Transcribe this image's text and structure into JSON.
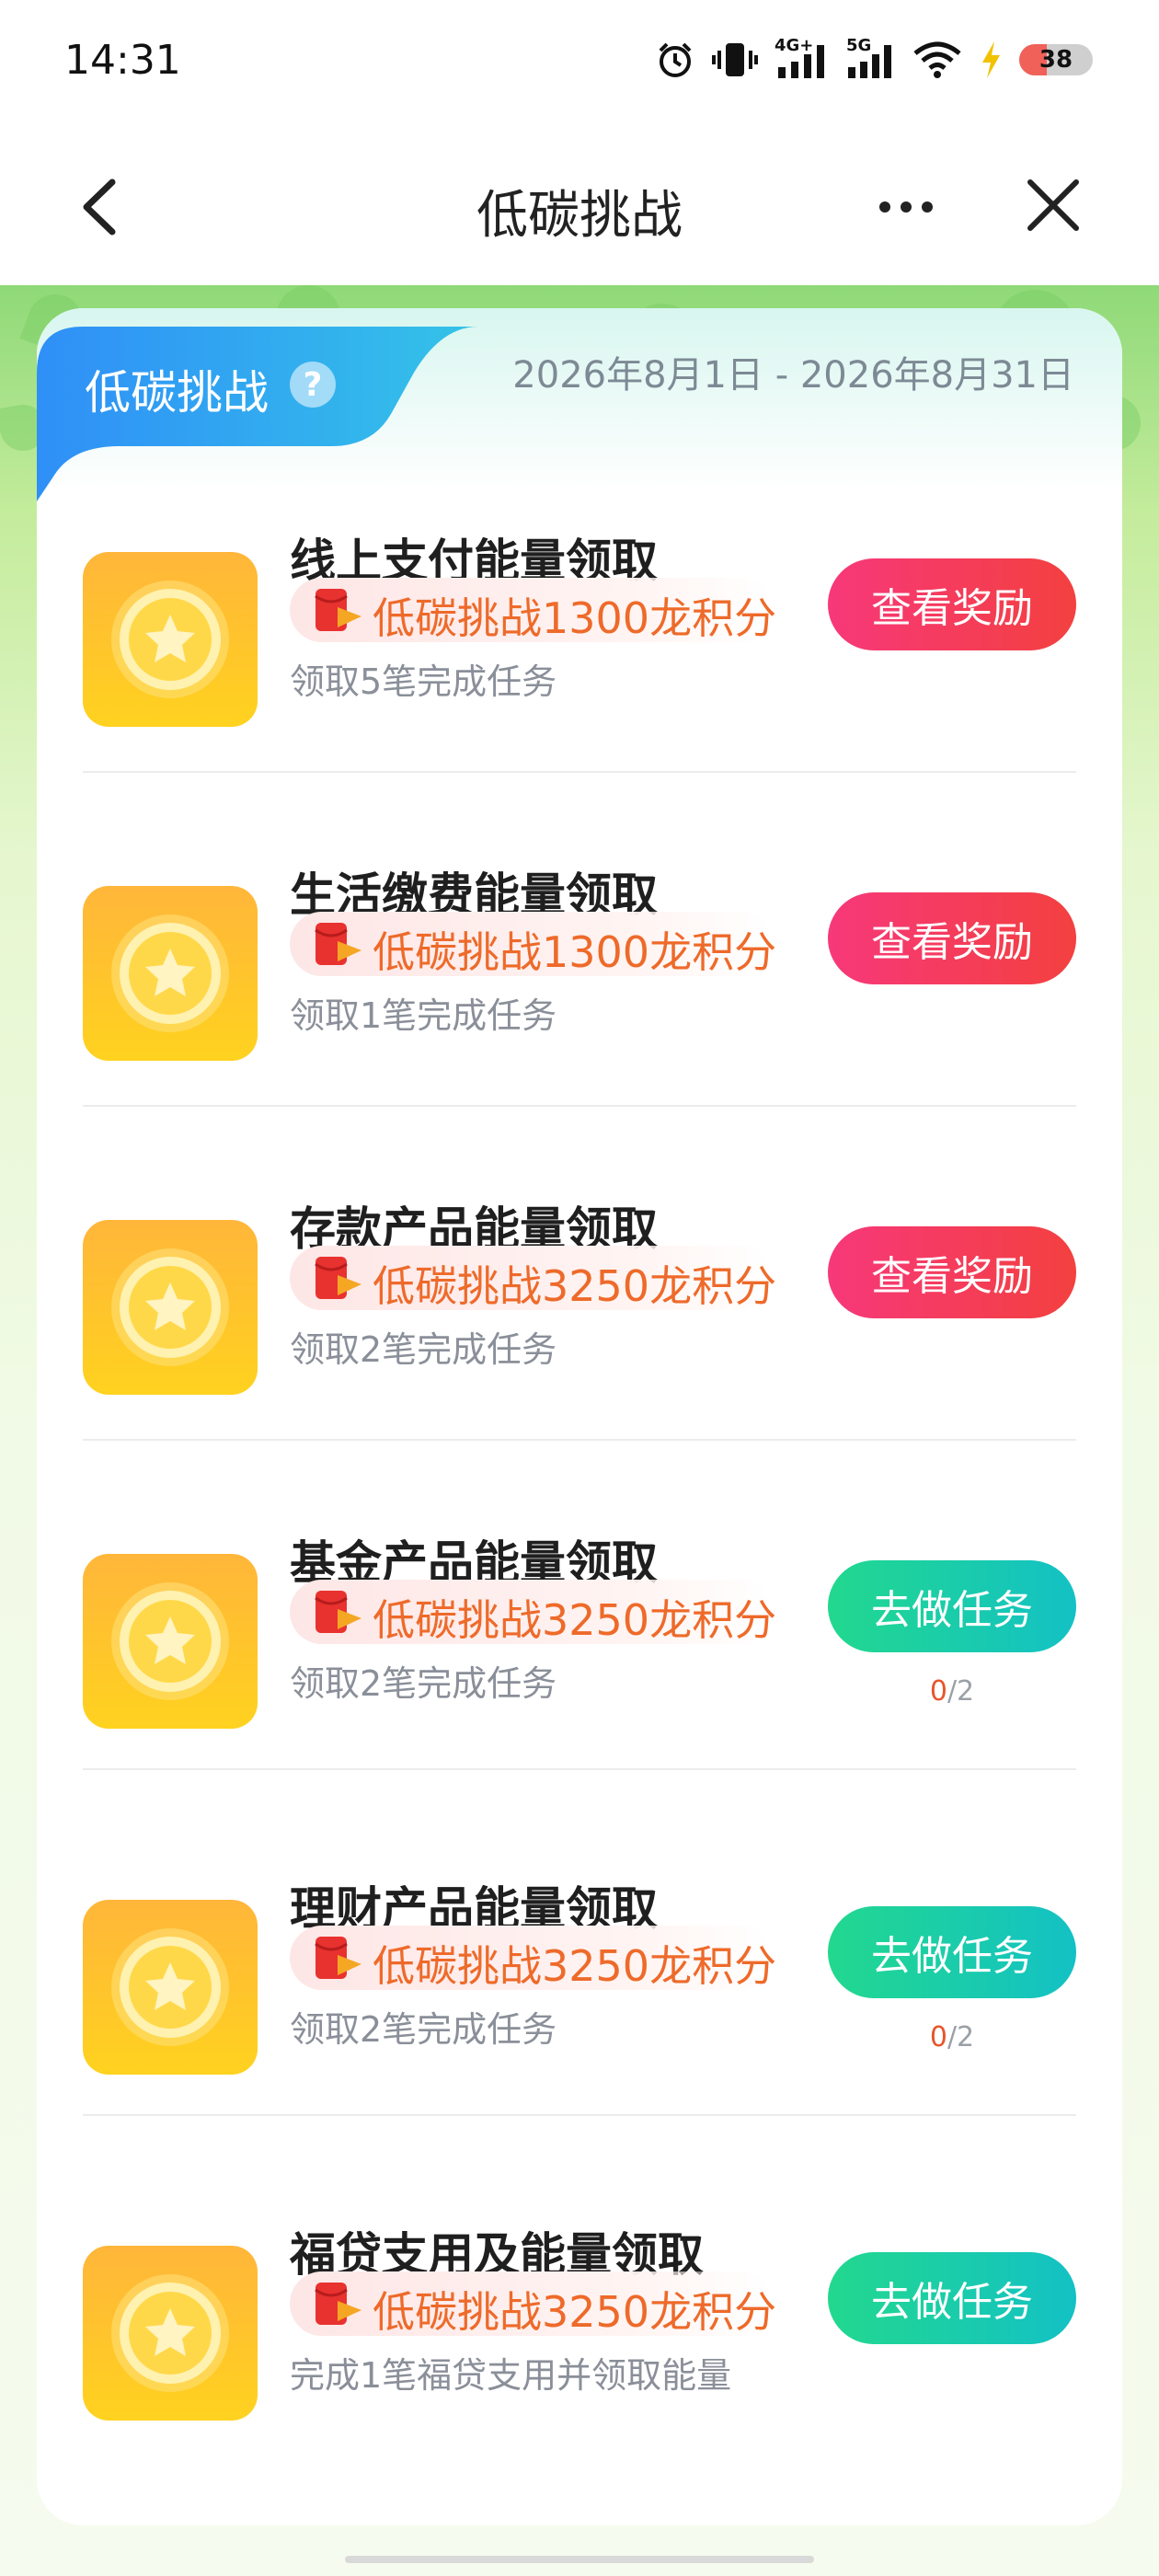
{
  "status_bar": {
    "time": "14:31",
    "battery": "38",
    "network_4g": "4G+",
    "network_5g": "5G"
  },
  "nav": {
    "title": "低碳挑战"
  },
  "card": {
    "tab_title": "低碳挑战",
    "help_glyph": "?",
    "date_range": "2026年8月1日 - 2026年8月31日"
  },
  "tasks": [
    {
      "name": "线上支付能量领取",
      "reward": "低碳挑战1300龙积分",
      "desc": "领取5笔完成任务",
      "button": "查看奖励",
      "button_style": "red",
      "progress_done": "",
      "progress_sep": "",
      "progress_total": ""
    },
    {
      "name": "生活缴费能量领取",
      "reward": "低碳挑战1300龙积分",
      "desc": "领取1笔完成任务",
      "button": "查看奖励",
      "button_style": "red",
      "progress_done": "",
      "progress_sep": "",
      "progress_total": ""
    },
    {
      "name": "存款产品能量领取",
      "reward": "低碳挑战3250龙积分",
      "desc": "领取2笔完成任务",
      "button": "查看奖励",
      "button_style": "red",
      "progress_done": "",
      "progress_sep": "",
      "progress_total": ""
    },
    {
      "name": "基金产品能量领取",
      "reward": "低碳挑战3250龙积分",
      "desc": "领取2笔完成任务",
      "button": "去做任务",
      "button_style": "green",
      "progress_done": "0",
      "progress_sep": "/",
      "progress_total": "2"
    },
    {
      "name": "理财产品能量领取",
      "reward": "低碳挑战3250龙积分",
      "desc": "领取2笔完成任务",
      "button": "去做任务",
      "button_style": "green",
      "progress_done": "0",
      "progress_sep": "/",
      "progress_total": "2"
    },
    {
      "name": "福贷支用及能量领取",
      "reward": "低碳挑战3250龙积分",
      "desc": "完成1笔福贷支用并领取能量",
      "button": "去做任务",
      "button_style": "green",
      "progress_done": "",
      "progress_sep": "",
      "progress_total": ""
    }
  ],
  "icons": {
    "back": "chevron-left-icon",
    "more": "more-dots-icon",
    "close": "close-icon",
    "task": "coin-star-icon",
    "reward": "red-envelope-icon",
    "help": "question-icon"
  },
  "colors": {
    "accent_blue": "#2f8ff7",
    "button_red": "#f4395f",
    "button_green": "#19cfa6",
    "reward_orange": "#ee6a2a",
    "icon_gold": "#ffc229"
  }
}
